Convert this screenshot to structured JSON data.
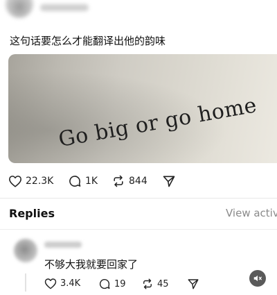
{
  "post": {
    "text": "这句话要怎么才能翻译出他的韵味",
    "image_text": "Go big or go home",
    "stats": {
      "likes": "22.3K",
      "comments": "1K",
      "reposts": "844"
    }
  },
  "replies_section": {
    "title": "Replies",
    "view_activity": "View activi"
  },
  "reply": {
    "text": "不够大我就要回家了",
    "stats": {
      "likes": "3.4K",
      "comments": "19",
      "reposts": "45"
    }
  },
  "icons": {
    "like": "heart-icon",
    "comment": "speech-bubble-icon",
    "repost": "repost-icon",
    "share": "paper-plane-icon",
    "sound": "mute-icon"
  },
  "colors": {
    "text": "#111111",
    "muted": "#8a8a8a",
    "divider": "#e7e7e7",
    "sound_button": "#5a5a5a"
  }
}
